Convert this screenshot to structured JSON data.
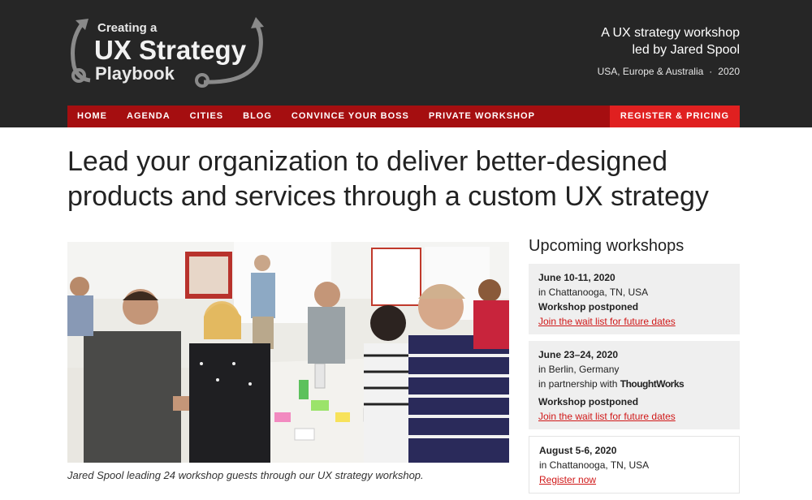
{
  "logo": {
    "line1": "Creating a",
    "line2": "UX Strategy",
    "line3": "Playbook"
  },
  "tagline": {
    "line1": "A UX strategy workshop",
    "line2": "led by Jared Spool",
    "regions": "USA, Europe & Australia",
    "separator": "·",
    "year": "2020"
  },
  "nav": {
    "items": [
      "HOME",
      "AGENDA",
      "CITIES",
      "BLOG",
      "CONVINCE YOUR BOSS",
      "PRIVATE WORKSHOP"
    ],
    "register": "REGISTER & PRICING"
  },
  "headline": "Lead your organization to deliver better-designed products and services through a custom UX strategy",
  "photo_caption": "Jared Spool leading 24 workshop guests through our UX strategy workshop.",
  "sidebar": {
    "title": "Upcoming workshops",
    "workshops": [
      {
        "date": "June 10-11, 2020",
        "location": "in Chattanooga, TN, USA",
        "status": "Workshop postponed",
        "link": "Join the wait list for future dates"
      },
      {
        "date": "June 23–24, 2020",
        "location": "in Berlin, Germany",
        "partner_prefix": "in partnership with",
        "partner": "ThoughtWorks",
        "status": "Workshop postponed",
        "link": "Join the wait list for future dates"
      },
      {
        "date": "August 5-6, 2020",
        "location": "in Chattanooga, TN, USA",
        "link": "Register now"
      }
    ]
  },
  "colors": {
    "header_bg": "#262626",
    "nav_bg": "#a50e10",
    "register_bg": "#e02020",
    "link": "#d01818",
    "card_bg": "#efefef"
  }
}
